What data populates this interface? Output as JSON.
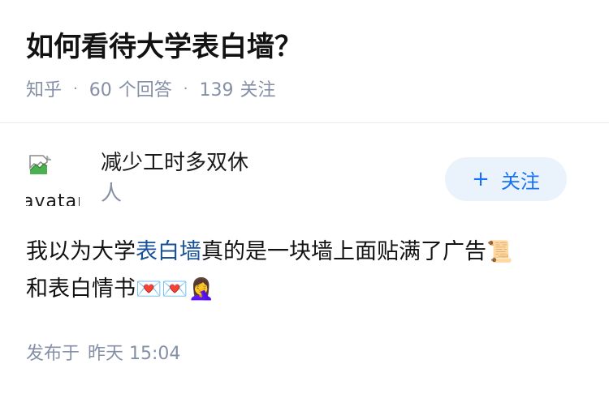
{
  "question": {
    "title": "如何看待大学表白墙？",
    "source": "知乎",
    "separator": "·",
    "answer_count": "60",
    "answer_label": "个回答",
    "follow_count": "139",
    "follow_label": "关注"
  },
  "answer": {
    "author": {
      "avatar_alt": "avatar",
      "name_line1": "减少工时多双休",
      "name_line2": "人",
      "follow_button": {
        "icon": "plus-icon",
        "label": "关注"
      }
    },
    "content": {
      "text_before": "我以为大学",
      "link_text": "表白墙",
      "text_after": "真的是一块墙上面贴满了广告",
      "emoji_scroll": "📜",
      "line2_text": "和表白情书",
      "emoji_love_letters": "💌💌",
      "emoji_facepalm": "🤦‍♀️"
    },
    "footer": {
      "published_label": "发布于",
      "time": "昨天 15:04"
    }
  },
  "colors": {
    "meta_gray": "#8590a6",
    "link_blue": "#175199",
    "button_blue": "#1772f6",
    "button_bg": "#eaf2fb"
  }
}
